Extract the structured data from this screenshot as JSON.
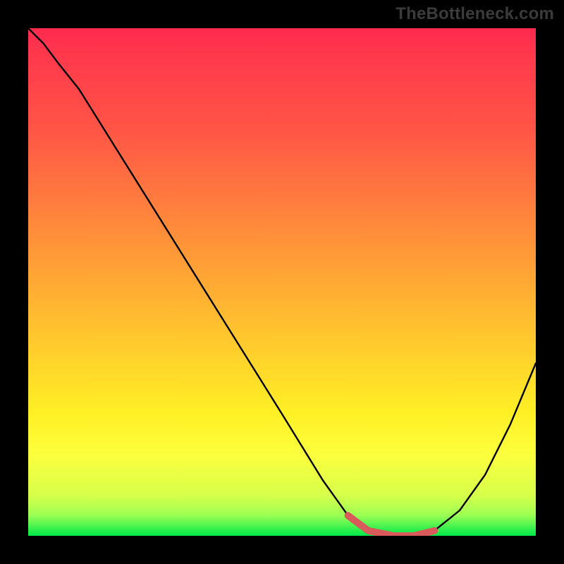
{
  "watermark": "TheBottleneck.com",
  "chart_data": {
    "type": "line",
    "title": "",
    "xlabel": "",
    "ylabel": "",
    "xlim": [
      0,
      100
    ],
    "ylim": [
      0,
      100
    ],
    "series": [
      {
        "name": "bottleneck-curve",
        "x": [
          0,
          3,
          6,
          10,
          20,
          30,
          40,
          50,
          58,
          63,
          67,
          72,
          76,
          80,
          85,
          90,
          95,
          100
        ],
        "y": [
          100,
          97,
          93,
          88,
          72,
          56,
          40,
          24,
          11,
          4,
          1,
          0,
          0,
          1,
          5,
          12,
          22,
          34
        ]
      }
    ],
    "highlight_segment": {
      "name": "flat-minimum",
      "color": "#d85a5a",
      "x": [
        63,
        67,
        72,
        76,
        80
      ],
      "y": [
        4,
        1,
        0,
        0,
        1
      ]
    },
    "gradient_stops": [
      {
        "pos": 0,
        "color": "#ff2a4e"
      },
      {
        "pos": 20,
        "color": "#ff5546"
      },
      {
        "pos": 48,
        "color": "#ffa335"
      },
      {
        "pos": 76,
        "color": "#fff025"
      },
      {
        "pos": 96,
        "color": "#9bff54"
      },
      {
        "pos": 100,
        "color": "#00e84a"
      }
    ]
  }
}
